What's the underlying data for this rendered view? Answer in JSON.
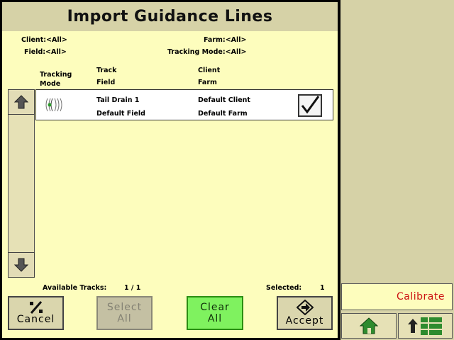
{
  "title": "Import Guidance Lines",
  "filters": {
    "client": "Client:<All>",
    "farm": "Farm:<All>",
    "field": "Field:<All>",
    "tracking_mode": "Tracking Mode:<All>"
  },
  "columns": {
    "mode_line1": "Tracking",
    "mode_line2": "Mode",
    "track": "Track",
    "field": "Field",
    "client": "Client",
    "farm": "Farm"
  },
  "rows": [
    {
      "track": "Tail Drain 1",
      "field": "Default Field",
      "client": "Default Client",
      "farm": "Default Farm",
      "checked": true,
      "mode_icon": "curve-track-icon"
    }
  ],
  "status": {
    "available_label": "Available Tracks:",
    "available_value": "1 / 1",
    "selected_label": "Selected:",
    "selected_value": "1"
  },
  "buttons": {
    "cancel": "Cancel",
    "select_all_l1": "Select",
    "select_all_l2": "All",
    "clear_all_l1": "Clear",
    "clear_all_l2": "All",
    "accept": "Accept"
  },
  "sidebar": {
    "calibrate": "Calibrate"
  },
  "colors": {
    "background": "#fdfdbd",
    "title_bar": "#d6d2a7",
    "clear_all_green": "#7ff25f",
    "calibrate_text": "#cc1111"
  }
}
